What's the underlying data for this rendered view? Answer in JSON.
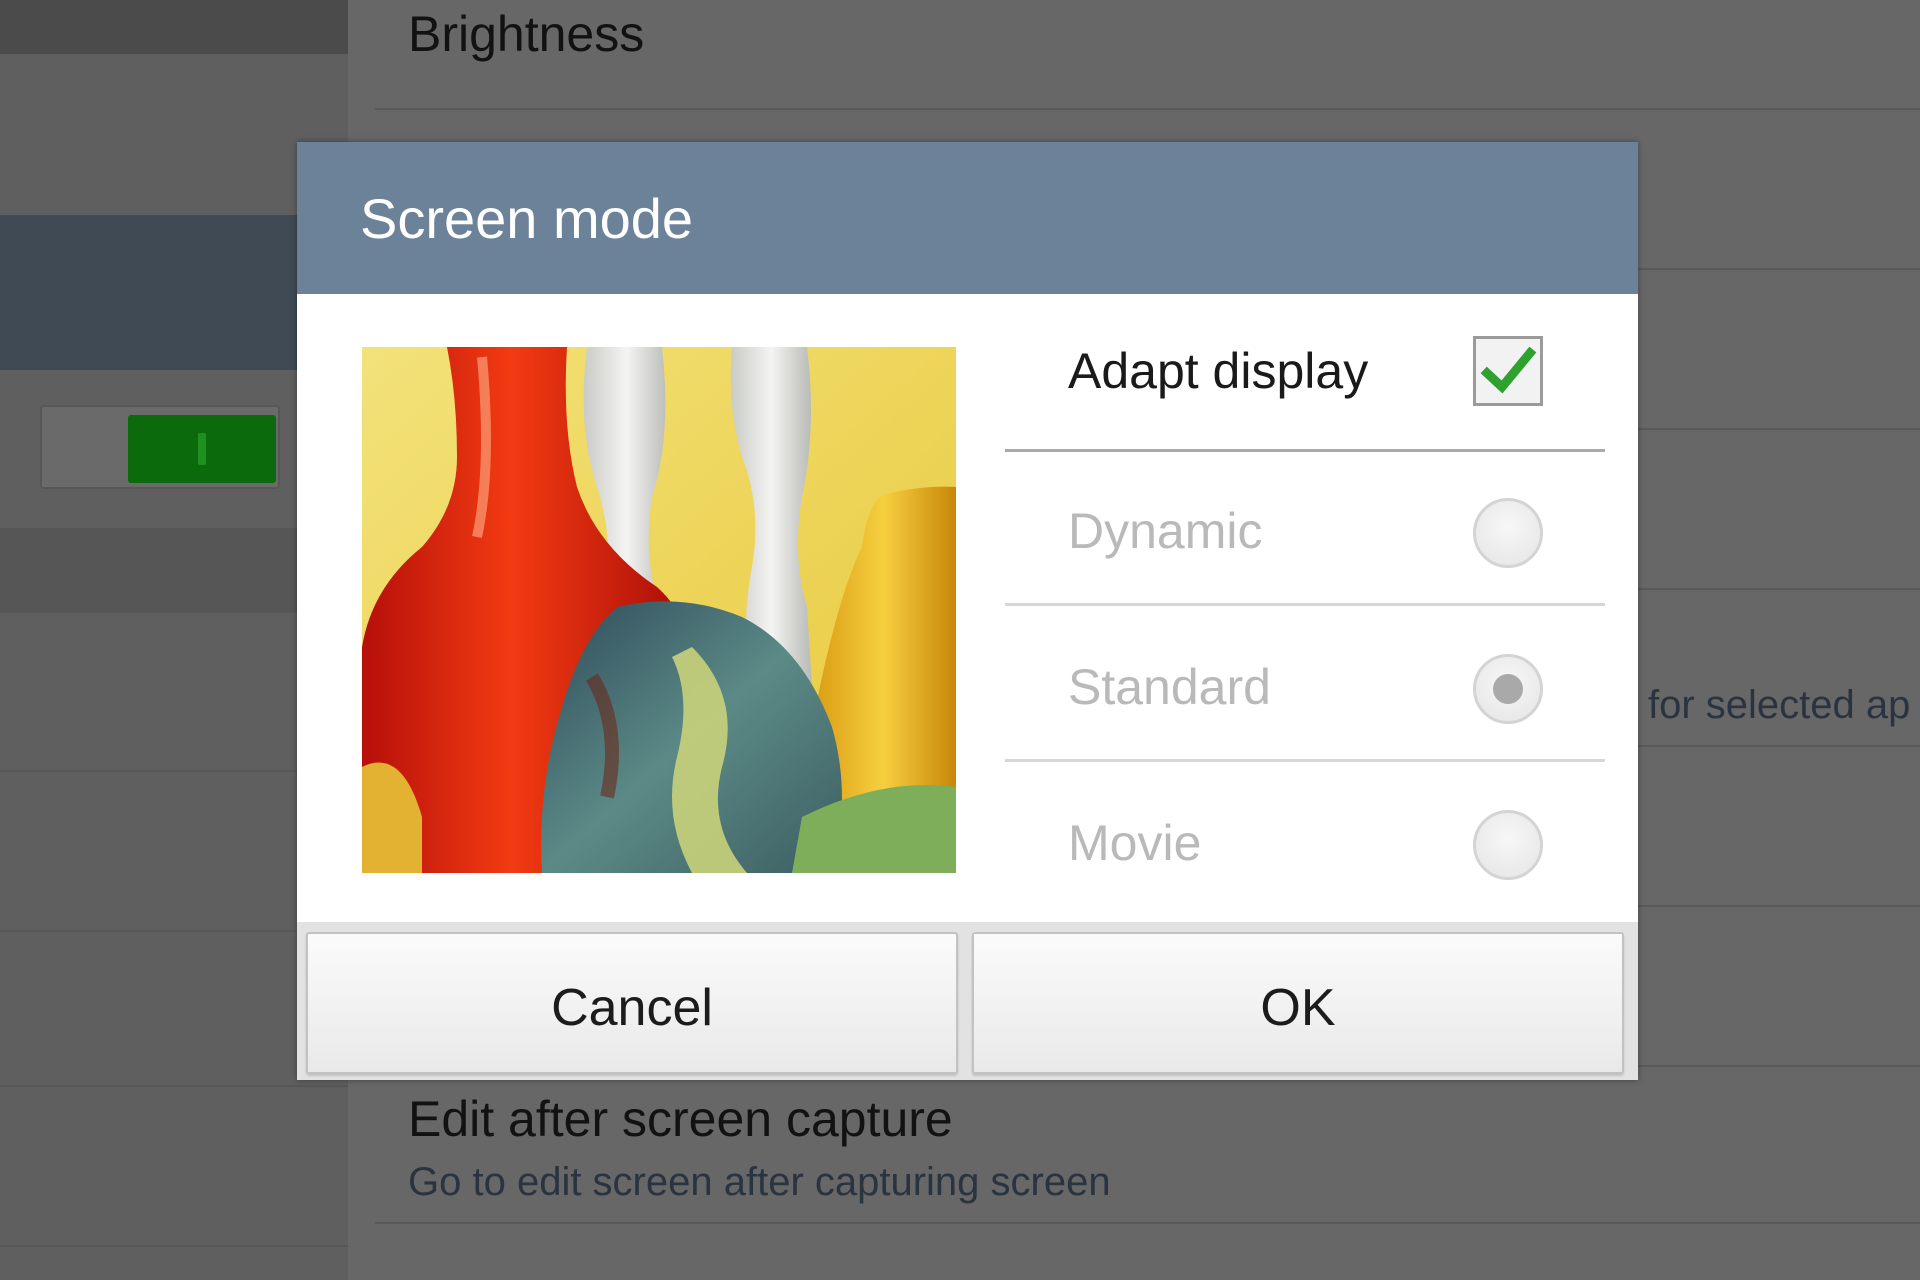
{
  "background": {
    "brightness_title": "Brightness",
    "partial_text": "for selected ap",
    "edit_capture_title": "Edit after screen capture",
    "edit_capture_subtitle": "Go to edit screen after capturing screen",
    "toggle_state": "on"
  },
  "dialog": {
    "title": "Screen mode",
    "preview_image": "colorful glass vases",
    "options": [
      {
        "label": "Adapt display",
        "control": "checkbox",
        "checked": true,
        "enabled": true
      },
      {
        "label": "Dynamic",
        "control": "radio",
        "selected": false,
        "enabled": false
      },
      {
        "label": "Standard",
        "control": "radio",
        "selected": true,
        "enabled": false
      },
      {
        "label": "Movie",
        "control": "radio",
        "selected": false,
        "enabled": false
      }
    ],
    "buttons": {
      "cancel": "Cancel",
      "ok": "OK"
    }
  },
  "colors": {
    "header": "#6c8299",
    "checkmark": "#2ea12e",
    "toggle_on": "#0b6a0b"
  }
}
